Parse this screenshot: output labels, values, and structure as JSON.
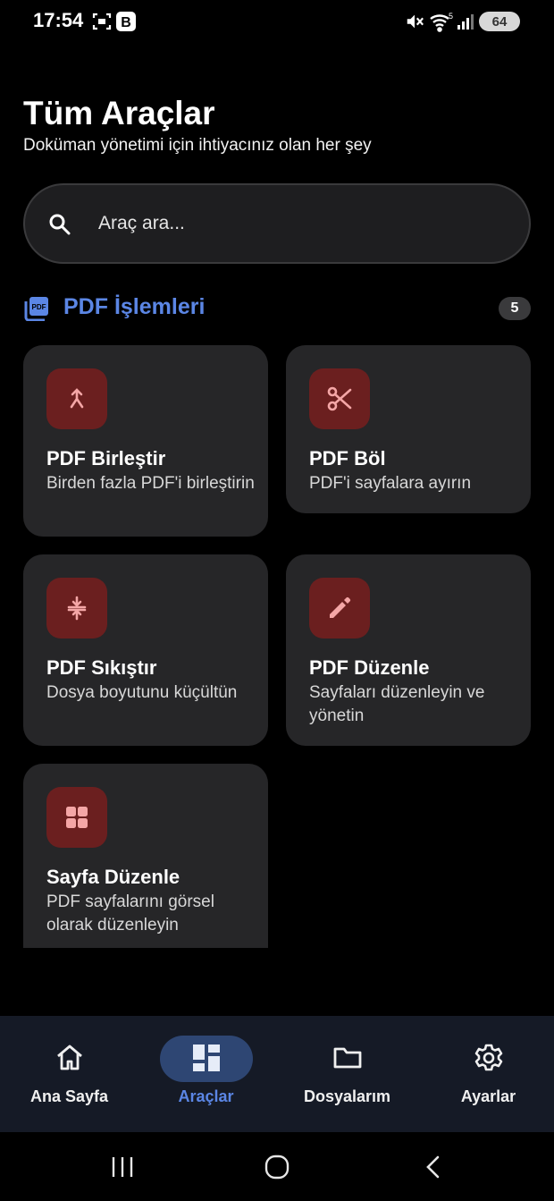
{
  "status_bar": {
    "time": "17:54",
    "battery": "64",
    "icons": [
      "screenshot-icon",
      "b-badge-icon",
      "mute-icon",
      "wifi-icon",
      "signal-icon"
    ]
  },
  "header": {
    "title": "Tüm Araçlar",
    "subtitle": "Doküman yönetimi için ihtiyacınız olan her şey"
  },
  "search": {
    "placeholder": "Araç ara..."
  },
  "section": {
    "title": "PDF İşlemleri",
    "count": "5",
    "accent_color": "#5b86e5"
  },
  "tools": [
    {
      "title": "PDF Birleştir",
      "description": "Birden fazla PDF'i birleştirin",
      "icon": "merge-icon"
    },
    {
      "title": "PDF Böl",
      "description": "PDF'i sayfalara ayırın",
      "icon": "scissors-icon"
    },
    {
      "title": "PDF Sıkıştır",
      "description": "Dosya boyutunu küçültün",
      "icon": "compress-icon"
    },
    {
      "title": "PDF Düzenle",
      "description": "Sayfaları düzenleyin ve yönetin",
      "icon": "pencil-icon"
    },
    {
      "title": "Sayfa Düzenle",
      "description": "PDF sayfalarını görsel olarak düzenleyin",
      "icon": "grid-icon"
    }
  ],
  "colors": {
    "card_bg": "#262628",
    "icon_box_bg": "#6b1f1f",
    "icon_fg": "#f4a6a6",
    "nav_bg": "#151a26",
    "nav_active": "#2e4673"
  },
  "bottom_nav": {
    "items": [
      {
        "label": "Ana Sayfa",
        "icon": "home-icon",
        "active": false
      },
      {
        "label": "Araçlar",
        "icon": "dashboard-icon",
        "active": true
      },
      {
        "label": "Dosyalarım",
        "icon": "folder-icon",
        "active": false
      },
      {
        "label": "Ayarlar",
        "icon": "gear-icon",
        "active": false
      }
    ]
  },
  "system_nav": [
    "recents-icon",
    "home-circle-icon",
    "back-icon"
  ]
}
